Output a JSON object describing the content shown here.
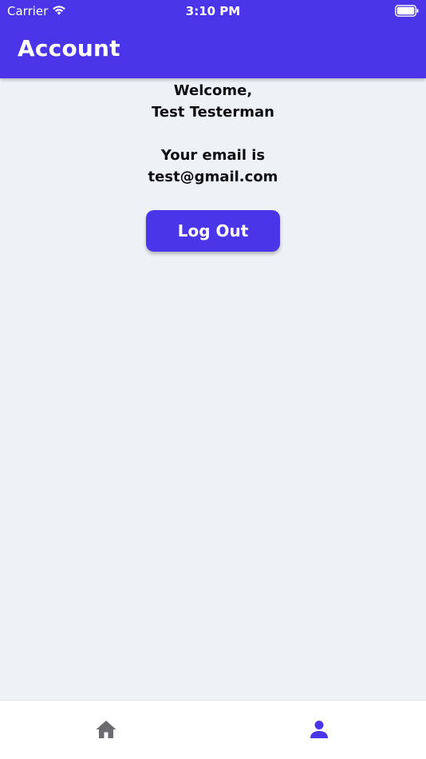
{
  "status_bar": {
    "carrier": "Carrier",
    "time": "3:10 PM",
    "icons": [
      "wifi-icon",
      "battery-icon"
    ]
  },
  "header": {
    "title": "Account"
  },
  "main": {
    "welcome_line1": "Welcome,",
    "welcome_name": "Test Testerman",
    "email_label": "Your email is",
    "email_value": "test@gmail.com",
    "logout_label": "Log Out"
  },
  "tab_bar": {
    "tabs": [
      {
        "icon": "home-icon",
        "active": false
      },
      {
        "icon": "person-icon",
        "active": true
      }
    ]
  },
  "colors": {
    "accent": "#4a35e8",
    "background": "#eef2f7",
    "inactive_icon": "#6b6b70"
  }
}
